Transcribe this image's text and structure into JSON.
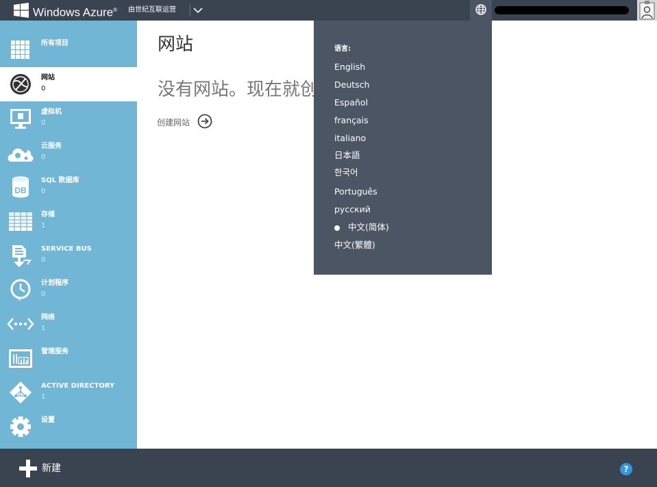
{
  "header": {
    "brand": "Windows Azure",
    "brand_mark": "®",
    "operator": "由世纪互联运营",
    "subscription_chevron_icon": "chevron-down-icon",
    "language_icon": "globe-icon"
  },
  "sidebar": {
    "items": [
      {
        "label": "所有项目",
        "count": "",
        "icon": "grid-icon"
      },
      {
        "label": "网站",
        "count": "0",
        "icon": "website-globe-icon",
        "active": true
      },
      {
        "label": "虚拟机",
        "count": "0",
        "icon": "monitor-icon"
      },
      {
        "label": "云服务",
        "count": "0",
        "icon": "cloud-gear-icon"
      },
      {
        "label": "SQL 数据库",
        "count": "0",
        "icon": "database-icon"
      },
      {
        "label": "存储",
        "count": "1",
        "icon": "table-icon"
      },
      {
        "label": "SERVICE BUS",
        "count": "0",
        "icon": "service-bus-icon"
      },
      {
        "label": "计划程序",
        "count": "0",
        "icon": "clock-icon"
      },
      {
        "label": "网络",
        "count": "1",
        "icon": "network-icon"
      },
      {
        "label": "管理服务",
        "count": "",
        "icon": "management-icon"
      },
      {
        "label": "ACTIVE DIRECTORY",
        "count": "1",
        "icon": "active-directory-icon"
      },
      {
        "label": "设置",
        "count": "",
        "icon": "gear-icon"
      }
    ]
  },
  "main": {
    "title": "网站",
    "empty_message": "没有网站。现在就创建一个吧！",
    "create_link": "创建网站"
  },
  "language_menu": {
    "header": "语言:",
    "items": [
      "English",
      "Deutsch",
      "Español",
      "français",
      "italiano",
      "日本語",
      "한국어",
      "Português",
      "русский",
      "中文(简体)",
      "中文(繁體)"
    ],
    "selected": "中文(简体)"
  },
  "footer": {
    "new_label": "新建",
    "help_label": "?"
  },
  "colors": {
    "topbar": "#3a4350",
    "sidebar": "#72b6d6",
    "menu": "#4b5563",
    "help": "#3498db"
  }
}
